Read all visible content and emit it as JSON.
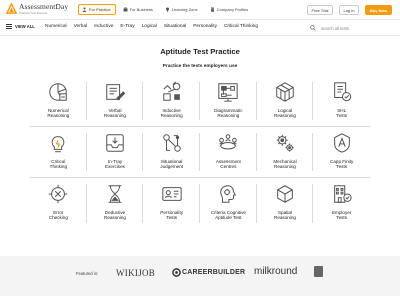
{
  "logo": {
    "name": "AssessmentDay",
    "tagline": "Practice Test Experts"
  },
  "tabs": [
    {
      "label": "For Practice",
      "active": true,
      "icon": "person-icon"
    },
    {
      "label": "For Business",
      "active": false,
      "icon": "briefcase-icon"
    },
    {
      "label": "Learning Zone",
      "active": false,
      "icon": "lightbulb-icon"
    },
    {
      "label": "Company Profiles",
      "active": false,
      "icon": "building-icon"
    }
  ],
  "header_buttons": {
    "free_trial": "Free Trial",
    "login": "Log in",
    "buy_now": "Buy Now"
  },
  "nav": {
    "view_all": "VIEW ALL",
    "links": [
      "Numerical",
      "Verbal",
      "Inductive",
      "E-Tray",
      "Logical",
      "Situational",
      "Personality",
      "Critical Thinking"
    ],
    "search_placeholder": "search all tests"
  },
  "hero": {
    "title": "Aptitude Test Practice",
    "subtitle": "Practice the tests employers use"
  },
  "tests": [
    {
      "label": "Numerical\nReasoning",
      "icon": "numerical-reasoning-icon"
    },
    {
      "label": "Verbal\nReasoning",
      "icon": "verbal-reasoning-icon"
    },
    {
      "label": "Inductive\nReasoning",
      "icon": "inductive-reasoning-icon"
    },
    {
      "label": "Diagrammatic\nReasoning",
      "icon": "diagrammatic-reasoning-icon"
    },
    {
      "label": "Logical\nReasoning",
      "icon": "logical-reasoning-icon"
    },
    {
      "label": "SHL\nTests",
      "icon": "shl-tests-icon"
    },
    {
      "label": "Critical\nThinking",
      "icon": "critical-thinking-icon"
    },
    {
      "label": "In-Tray\nExercises",
      "icon": "in-tray-icon"
    },
    {
      "label": "Situational\nJudgement",
      "icon": "situational-judgement-icon"
    },
    {
      "label": "Assessment\nCentres",
      "icon": "assessment-centres-icon"
    },
    {
      "label": "Mechanical\nReasoning",
      "icon": "mechanical-reasoning-icon"
    },
    {
      "label": "Capp Finity\nTests",
      "icon": "cappfinity-icon"
    },
    {
      "label": "Error\nChecking",
      "icon": "error-checking-icon"
    },
    {
      "label": "Deductive\nReasoning",
      "icon": "deductive-reasoning-icon"
    },
    {
      "label": "Personality\nTests",
      "icon": "personality-tests-icon"
    },
    {
      "label": "Criteria Cognitive\nAptitude Test",
      "icon": "ccat-icon"
    },
    {
      "label": "Spatial\nReasoning",
      "icon": "spatial-reasoning-icon"
    },
    {
      "label": "Employer\nTests",
      "icon": "employer-tests-icon"
    }
  ],
  "featured": {
    "label": "Featured in:",
    "brands": [
      "WIKIJOB",
      "CAREERBUILDER",
      "milkround"
    ]
  },
  "colors": {
    "accent": "#f39c12",
    "border": "#dcdcdc",
    "footer_bg": "#f4f4f4"
  }
}
